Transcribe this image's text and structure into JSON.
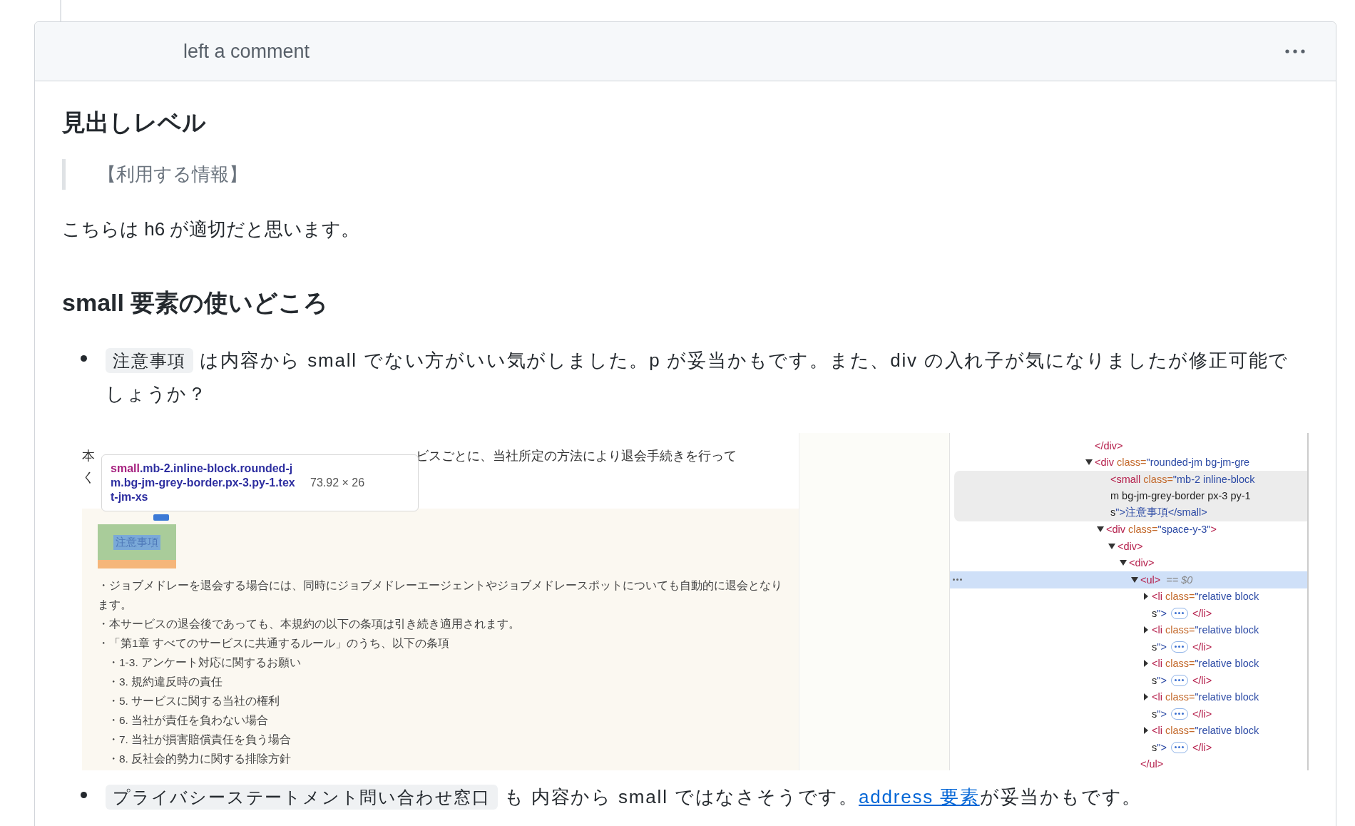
{
  "comment": {
    "header": "left a comment",
    "heading": "見出しレベル",
    "quote": "【利用する情報】",
    "paragraph": "こちらは h6 が適切だと思います。",
    "subheading": "small 要素の使いどころ",
    "items": [
      {
        "code": "注意事項",
        "text": "は内容から small でない方がいい気がしました。p が妥当かもです。また、div の入れ子が気になりましたが修正可能でしょうか？"
      },
      {
        "code": "プライバシーステートメント問い合わせ窓口",
        "text": "も 内容から small ではなさそうです。",
        "link": "address 要素",
        "after": "が妥当かもです。"
      }
    ]
  },
  "screenshot": {
    "page": {
      "line_start": "本",
      "line_rest": "ビスごとに、当社所定の方法により退会手続きを行って",
      "line_2": "く",
      "highlight_label": "注意事項",
      "bullets": [
        "・ジョブメドレーを退会する場合には、同時にジョブメドレーエージェントやジョブメドレースポットについても自動的に退会となります。",
        "・本サービスの退会後であっても、本規約の以下の条項は引き続き適用されます。",
        "・「第1章 すべてのサービスに共通するルール」のうち、以下の条項"
      ],
      "sub_bullets": [
        "・1-3. アンケート対応に関するお願い",
        "・3. 規約違反時の責任",
        "・5. サービスに関する当社の権利",
        "・6. 当社が責任を負わない場合",
        "・7. 当社が損害賠償責任を負う場合",
        "・8. 反社会的勢力に関する排除方針"
      ]
    },
    "tooltip": {
      "tag": "small",
      "classes": ".mb-2.inline-block.rounded-jm.bg-jm-grey-border.px-3.py-1.text-jm-xs",
      "size": "73.92 × 26"
    },
    "devtools": [
      {
        "lines": [
          "</div>"
        ]
      },
      {
        "lines": [
          "<div class=\"rounded-jm bg-jm-gre"
        ],
        "expanded": true,
        "children": [
          {
            "lines": [
              "<small class=\"mb-2 inline-block",
              "m bg-jm-grey-border px-3 py-1",
              "s\">注意事項</small>"
            ],
            "hovered": true
          },
          {
            "lines": [
              "<div class=\"space-y-3\">"
            ],
            "expanded": true,
            "children": [
              {
                "lines": [
                  "<div>"
                ],
                "expanded": true,
                "children": [
                  {
                    "lines": [
                      "<div>"
                    ],
                    "expanded": true,
                    "children": [
                      {
                        "lines": [
                          "<ul>"
                        ],
                        "expanded": true,
                        "selected": true,
                        "suffix": "== $0",
                        "children": [
                          {
                            "lines": [
                              "<li class=\"relative block",
                              "s\">"
                            ],
                            "expanded": false,
                            "close": "</li>"
                          },
                          {
                            "lines": [
                              "<li class=\"relative block",
                              "s\">"
                            ],
                            "expanded": false,
                            "close": "</li>"
                          },
                          {
                            "lines": [
                              "<li class=\"relative block",
                              "s\">"
                            ],
                            "expanded": false,
                            "close": "</li>"
                          },
                          {
                            "lines": [
                              "<li class=\"relative block",
                              "s\">"
                            ],
                            "expanded": false,
                            "close": "</li>"
                          },
                          {
                            "lines": [
                              "<li class=\"relative block",
                              "s\">"
                            ],
                            "expanded": false,
                            "close": "</li>"
                          }
                        ],
                        "end": "</ul>"
                      }
                    ]
                  }
                ]
              }
            ]
          }
        ]
      }
    ]
  }
}
